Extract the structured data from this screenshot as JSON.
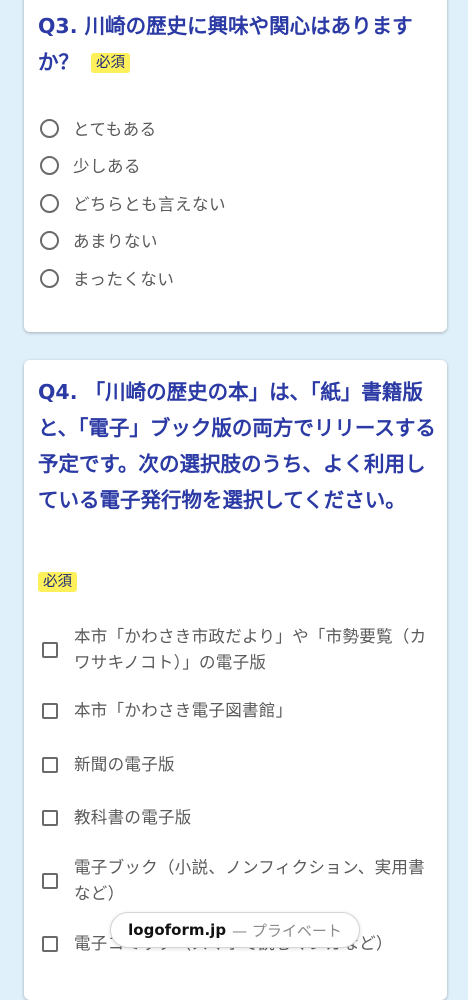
{
  "q3": {
    "title": "Q3. 川崎の歴史に興味や関心はありますか？",
    "required_label": "必須",
    "options": [
      {
        "label": "とてもある",
        "checked": false
      },
      {
        "label": "少しある",
        "checked": false
      },
      {
        "label": "どちらとも言えない",
        "checked": false
      },
      {
        "label": "あまりない",
        "checked": false
      },
      {
        "label": "まったくない",
        "checked": false
      }
    ]
  },
  "q4": {
    "title": "Q4. 「川崎の歴史の本」は、「紙」書籍版と、「電子」ブック版の両方でリリースする予定です。次の選択肢のうち、よく利用している電子発行物を選択してください。",
    "required_label": "必須",
    "options": [
      {
        "label": "本市「かわさき市政だより」や「市勢要覧（カワサキノコト）」の電子版",
        "checked": false
      },
      {
        "label": "本市「かわさき電子図書館」",
        "checked": false
      },
      {
        "label": "新聞の電子版",
        "checked": false
      },
      {
        "label": "教科書の電子版",
        "checked": false
      },
      {
        "label": "電子ブック（小説、ノンフィクション、実用書など）",
        "checked": false
      },
      {
        "label": "電子コミック（スマホで読むマンガなど）",
        "checked": false
      }
    ]
  },
  "footer": {
    "brand": "logoform.jp",
    "suffix": "— プライベート"
  },
  "colors": {
    "background": "#dff0fb",
    "title": "#2b3aa4",
    "badge": "#fdf05a"
  }
}
